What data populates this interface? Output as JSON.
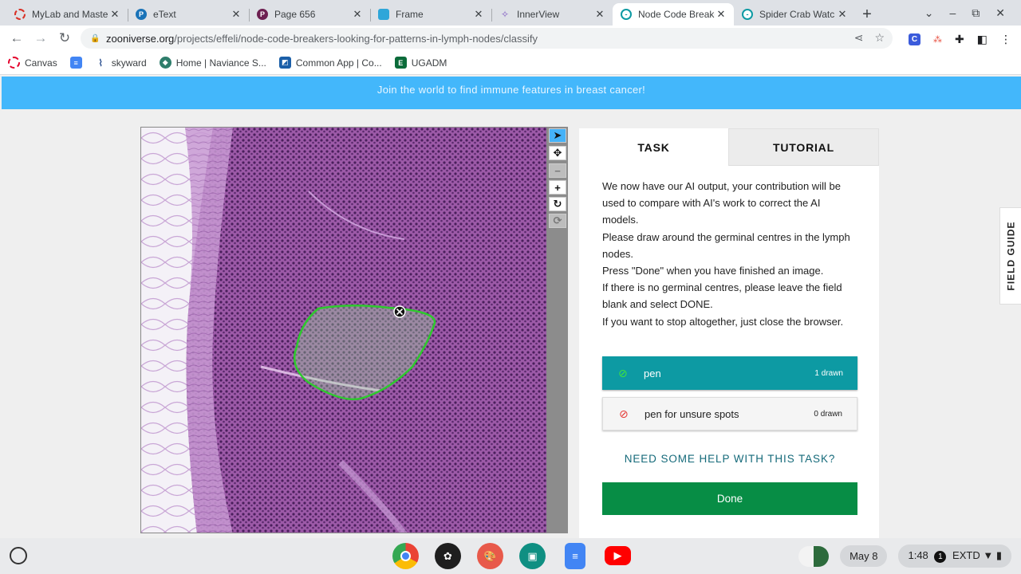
{
  "browser": {
    "tabs": [
      {
        "title": "MyLab and Maste",
        "icon": "pearson-red-icon",
        "color": "#d93025"
      },
      {
        "title": "eText",
        "icon": "pearson-p-icon",
        "color": "#1a73b8"
      },
      {
        "title": "Page 656",
        "icon": "pearson-p-dark-icon",
        "color": "#6d1f51"
      },
      {
        "title": "Frame",
        "icon": "frame-icon",
        "color": "#2ea6d9"
      },
      {
        "title": "InnerView",
        "icon": "innerview-icon",
        "color": "#7e57c2"
      },
      {
        "title": "Node Code Breake",
        "icon": "zooniverse-icon",
        "color": "#0d9aa3",
        "active": true
      },
      {
        "title": "Spider Crab Watc",
        "icon": "zooniverse-icon",
        "color": "#0d9aa3"
      }
    ],
    "url_domain": "zooniverse.org",
    "url_path": "/projects/effeli/node-code-breakers-looking-for-patterns-in-lymph-nodes/classify",
    "bookmarks": [
      {
        "label": "Canvas",
        "color": "#e4002b"
      },
      {
        "label": "",
        "color": "#4285f4"
      },
      {
        "label": "skyward",
        "color": "#2a4f8f"
      },
      {
        "label": "Home | Naviance S...",
        "color": "#2e7d6b"
      },
      {
        "label": "Common App | Co...",
        "color": "#1b5fa8"
      },
      {
        "label": "UGADM",
        "color": "#0b6b3a"
      }
    ]
  },
  "page": {
    "banner": "Join the world to find immune features in breast cancer!",
    "task_tab": "TASK",
    "tutorial_tab": "TUTORIAL",
    "instructions": [
      "We now have our AI output, your contribution will be used to compare with AI's work to correct the AI models.",
      "Please draw around the germinal centres in the lymph nodes.",
      "Press \"Done\" when you have finished an image.",
      "If there is no germinal centres, please leave the field blank and select DONE.",
      "If you want to stop altogether, just close the browser."
    ],
    "tools": [
      {
        "name": "pen",
        "count": "1 drawn",
        "icon": "pen-icon"
      },
      {
        "name": "pen for unsure spots",
        "count": "0 drawn",
        "icon": "pen-unsure-icon"
      }
    ],
    "help_link": "NEED SOME HELP WITH THIS TASK?",
    "done_button": "Done",
    "field_guide": "FIELD GUIDE",
    "viewer_tools": [
      "pointer-icon",
      "move-icon",
      "zoom-out-icon",
      "zoom-in-icon",
      "rotate-icon",
      "reset-icon"
    ]
  },
  "shelf": {
    "date": "May 8",
    "time": "1:48",
    "badge": "1",
    "network": "EXTD",
    "apps": [
      "chrome",
      "figma",
      "paint",
      "classroom",
      "docs",
      "youtube"
    ]
  }
}
